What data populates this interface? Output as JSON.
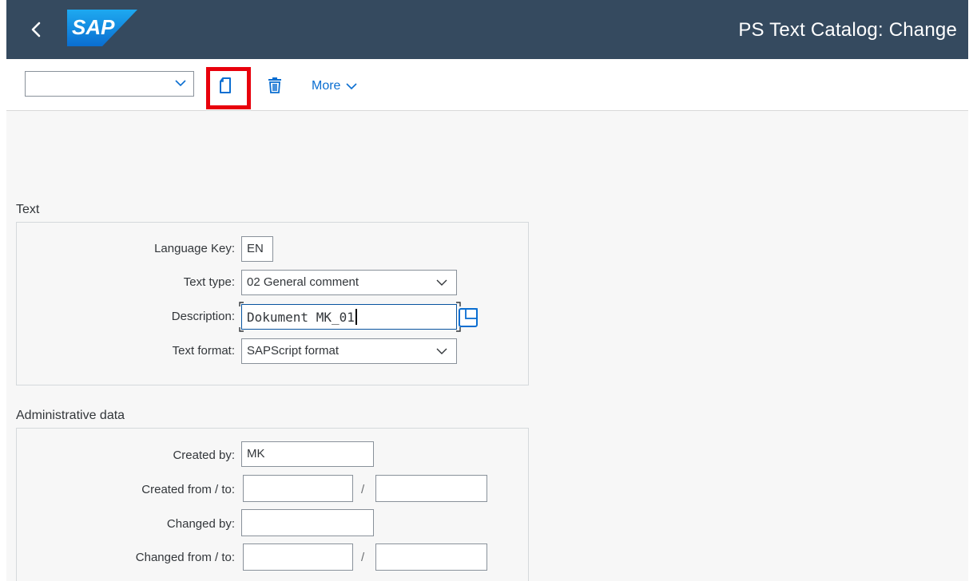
{
  "shell": {
    "title": "PS Text Catalog: Change",
    "logo_text": "SAP",
    "back_icon": "chevron-left-icon"
  },
  "toolbar": {
    "select_value": "",
    "new_icon": "new-document-icon",
    "delete_icon": "trash-icon",
    "more_label": "More"
  },
  "text_section": {
    "title": "Text",
    "language_key": {
      "label": "Language Key:",
      "value": "EN"
    },
    "text_type": {
      "label": "Text type:",
      "value": "02 General comment"
    },
    "description": {
      "label": "Description:",
      "value": "Dokument MK_01"
    },
    "text_format": {
      "label": "Text format:",
      "value": "SAPScript format"
    }
  },
  "admin_section": {
    "title": "Administrative data",
    "created_by": {
      "label": "Created by:",
      "value": "MK"
    },
    "created_from_to": {
      "label": "Created from / to:",
      "from": "",
      "to": "",
      "separator": "/"
    },
    "changed_by": {
      "label": "Changed by:",
      "value": ""
    },
    "changed_from_to": {
      "label": "Changed from / to:",
      "from": "",
      "to": "",
      "separator": "/"
    }
  },
  "colors": {
    "shell_bg": "#354a5f",
    "accent": "#0a6ed1",
    "highlight": "#e8000c"
  }
}
